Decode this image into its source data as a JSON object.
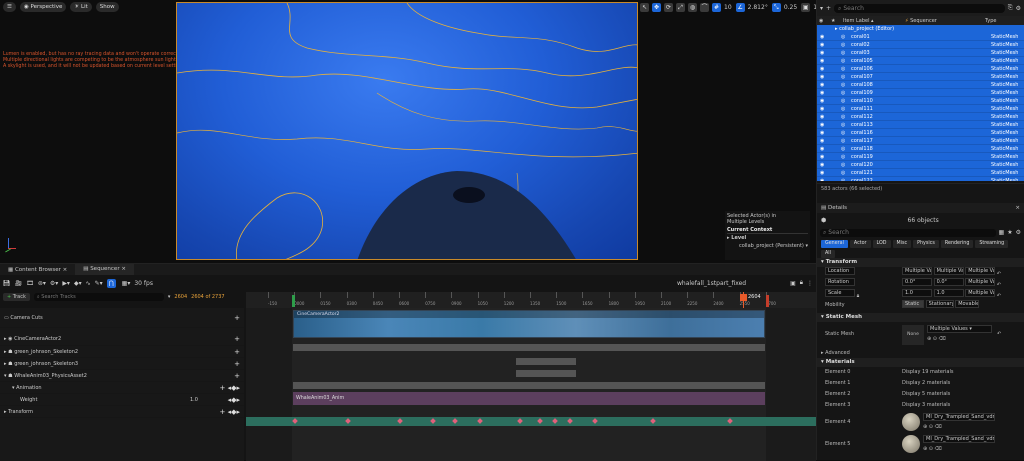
{
  "viewport": {
    "mode": "Perspective",
    "lighting": "Lit",
    "show": "Show",
    "warnings": [
      "Lumen is enabled, but has no ray tracing data and won't operate correctly.",
      "Multiple directional lights are competing to be the atmosphere sun light; the one with a valid atmosphere sun light index will be chosen.",
      "A skylight is used, and it will not be updated based on current level settings (in the scene)."
    ],
    "grid_value": "10",
    "angle_value": "2.812°",
    "scale_value": "0.25",
    "cam_value": "1",
    "selected_info": {
      "line1": "Selected Actor(s) in",
      "line2": "Multiple Levels",
      "context_label": "Current Context",
      "level_label": "Level",
      "level_value": "collab_project (Persistent)"
    }
  },
  "outliner": {
    "search_placeholder": "Search",
    "col_label": "Item Label",
    "col_seq": "Sequencer",
    "col_type": "Type",
    "root": "collab_project (Editor)",
    "rows": [
      {
        "label": "coral01",
        "type": "StaticMesh"
      },
      {
        "label": "coral02",
        "type": "StaticMesh"
      },
      {
        "label": "coral03",
        "type": "StaticMesh"
      },
      {
        "label": "coral105",
        "type": "StaticMesh"
      },
      {
        "label": "coral106",
        "type": "StaticMesh"
      },
      {
        "label": "coral107",
        "type": "StaticMesh"
      },
      {
        "label": "coral108",
        "type": "StaticMesh"
      },
      {
        "label": "coral109",
        "type": "StaticMesh"
      },
      {
        "label": "coral110",
        "type": "StaticMesh"
      },
      {
        "label": "coral111",
        "type": "StaticMesh"
      },
      {
        "label": "coral112",
        "type": "StaticMesh"
      },
      {
        "label": "coral113",
        "type": "StaticMesh"
      },
      {
        "label": "coral116",
        "type": "StaticMesh"
      },
      {
        "label": "coral117",
        "type": "StaticMesh"
      },
      {
        "label": "coral118",
        "type": "StaticMesh"
      },
      {
        "label": "coral119",
        "type": "StaticMesh"
      },
      {
        "label": "coral120",
        "type": "StaticMesh"
      },
      {
        "label": "coral121",
        "type": "StaticMesh"
      },
      {
        "label": "coral122",
        "type": "StaticMesh"
      }
    ],
    "footer": "583 actors (66 selected)"
  },
  "details": {
    "tab": "Details",
    "objects": "66 objects",
    "search_placeholder": "Search",
    "filters": [
      "General",
      "Actor",
      "LOD",
      "Misc",
      "Physics",
      "Rendering",
      "Streaming",
      "All"
    ],
    "transform": {
      "title": "Transform",
      "location": "Location",
      "rotation": "Rotation",
      "scale": "Scale",
      "mobility": "Mobility",
      "multi": "Multiple Valu",
      "rot_x": "0.0°",
      "rot_y": "0.0°",
      "scale_x": "1.0",
      "scale_y": "1.0",
      "mob_static": "Static",
      "mob_stationary": "Stationary",
      "mob_movable": "Movable"
    },
    "static_mesh": {
      "title": "Static Mesh",
      "label": "Static Mesh",
      "value": "Multiple Values",
      "thumb": "None"
    },
    "advanced": "Advanced",
    "materials": {
      "title": "Materials",
      "elements": [
        {
          "label": "Element 0",
          "value": "Display 19 materials"
        },
        {
          "label": "Element 1",
          "value": "Display 2 materials"
        },
        {
          "label": "Element 2",
          "value": "Display 5 materials"
        },
        {
          "label": "Element 3",
          "value": "Display 3 materials"
        },
        {
          "label": "Element 4",
          "value": "MI_Dry_Trampled_Sand_vdrgedb_8"
        },
        {
          "label": "Element 5",
          "value": "MI_Dry_Trampled_Sand_vdrgedb_8"
        }
      ]
    }
  },
  "sequencer": {
    "tab_content": "Content Browser",
    "tab_seq": "Sequencer",
    "fps": "30 fps",
    "seq_name": "whalefall_1stpart_fixed",
    "track_btn": "Track",
    "search_placeholder": "Search Tracks",
    "frame_a": "2604",
    "frame_b": "2604 of 2737",
    "playhead": "2604",
    "ticks": [
      "-150",
      "0000",
      "0150",
      "0300",
      "0450",
      "0600",
      "0750",
      "0900",
      "1050",
      "1200",
      "1350",
      "1500",
      "1650",
      "1800",
      "1950",
      "2100",
      "2250",
      "2400",
      "2550",
      "2700"
    ],
    "tracks": [
      {
        "name": "Camera Cuts"
      },
      {
        "name": "CineCameraActor2"
      },
      {
        "name": "green_johnson_Skeleton2"
      },
      {
        "name": "green_johnson_Skeleton3"
      },
      {
        "name": "WhaleAnim03_PhysicsAsset2"
      },
      {
        "name": "Animation"
      },
      {
        "name": "Weight",
        "value": "1.0"
      },
      {
        "name": "Transform"
      }
    ],
    "clip_camera": "CineCameraActor2",
    "clip_anim": "WhaleAnim03_Anim"
  },
  "colors": {
    "accent": "#1c66d8",
    "seq_green": "#2c6e5e",
    "clip_purple": "#5c3f5e",
    "timeline_orange": "#e85a2a"
  }
}
